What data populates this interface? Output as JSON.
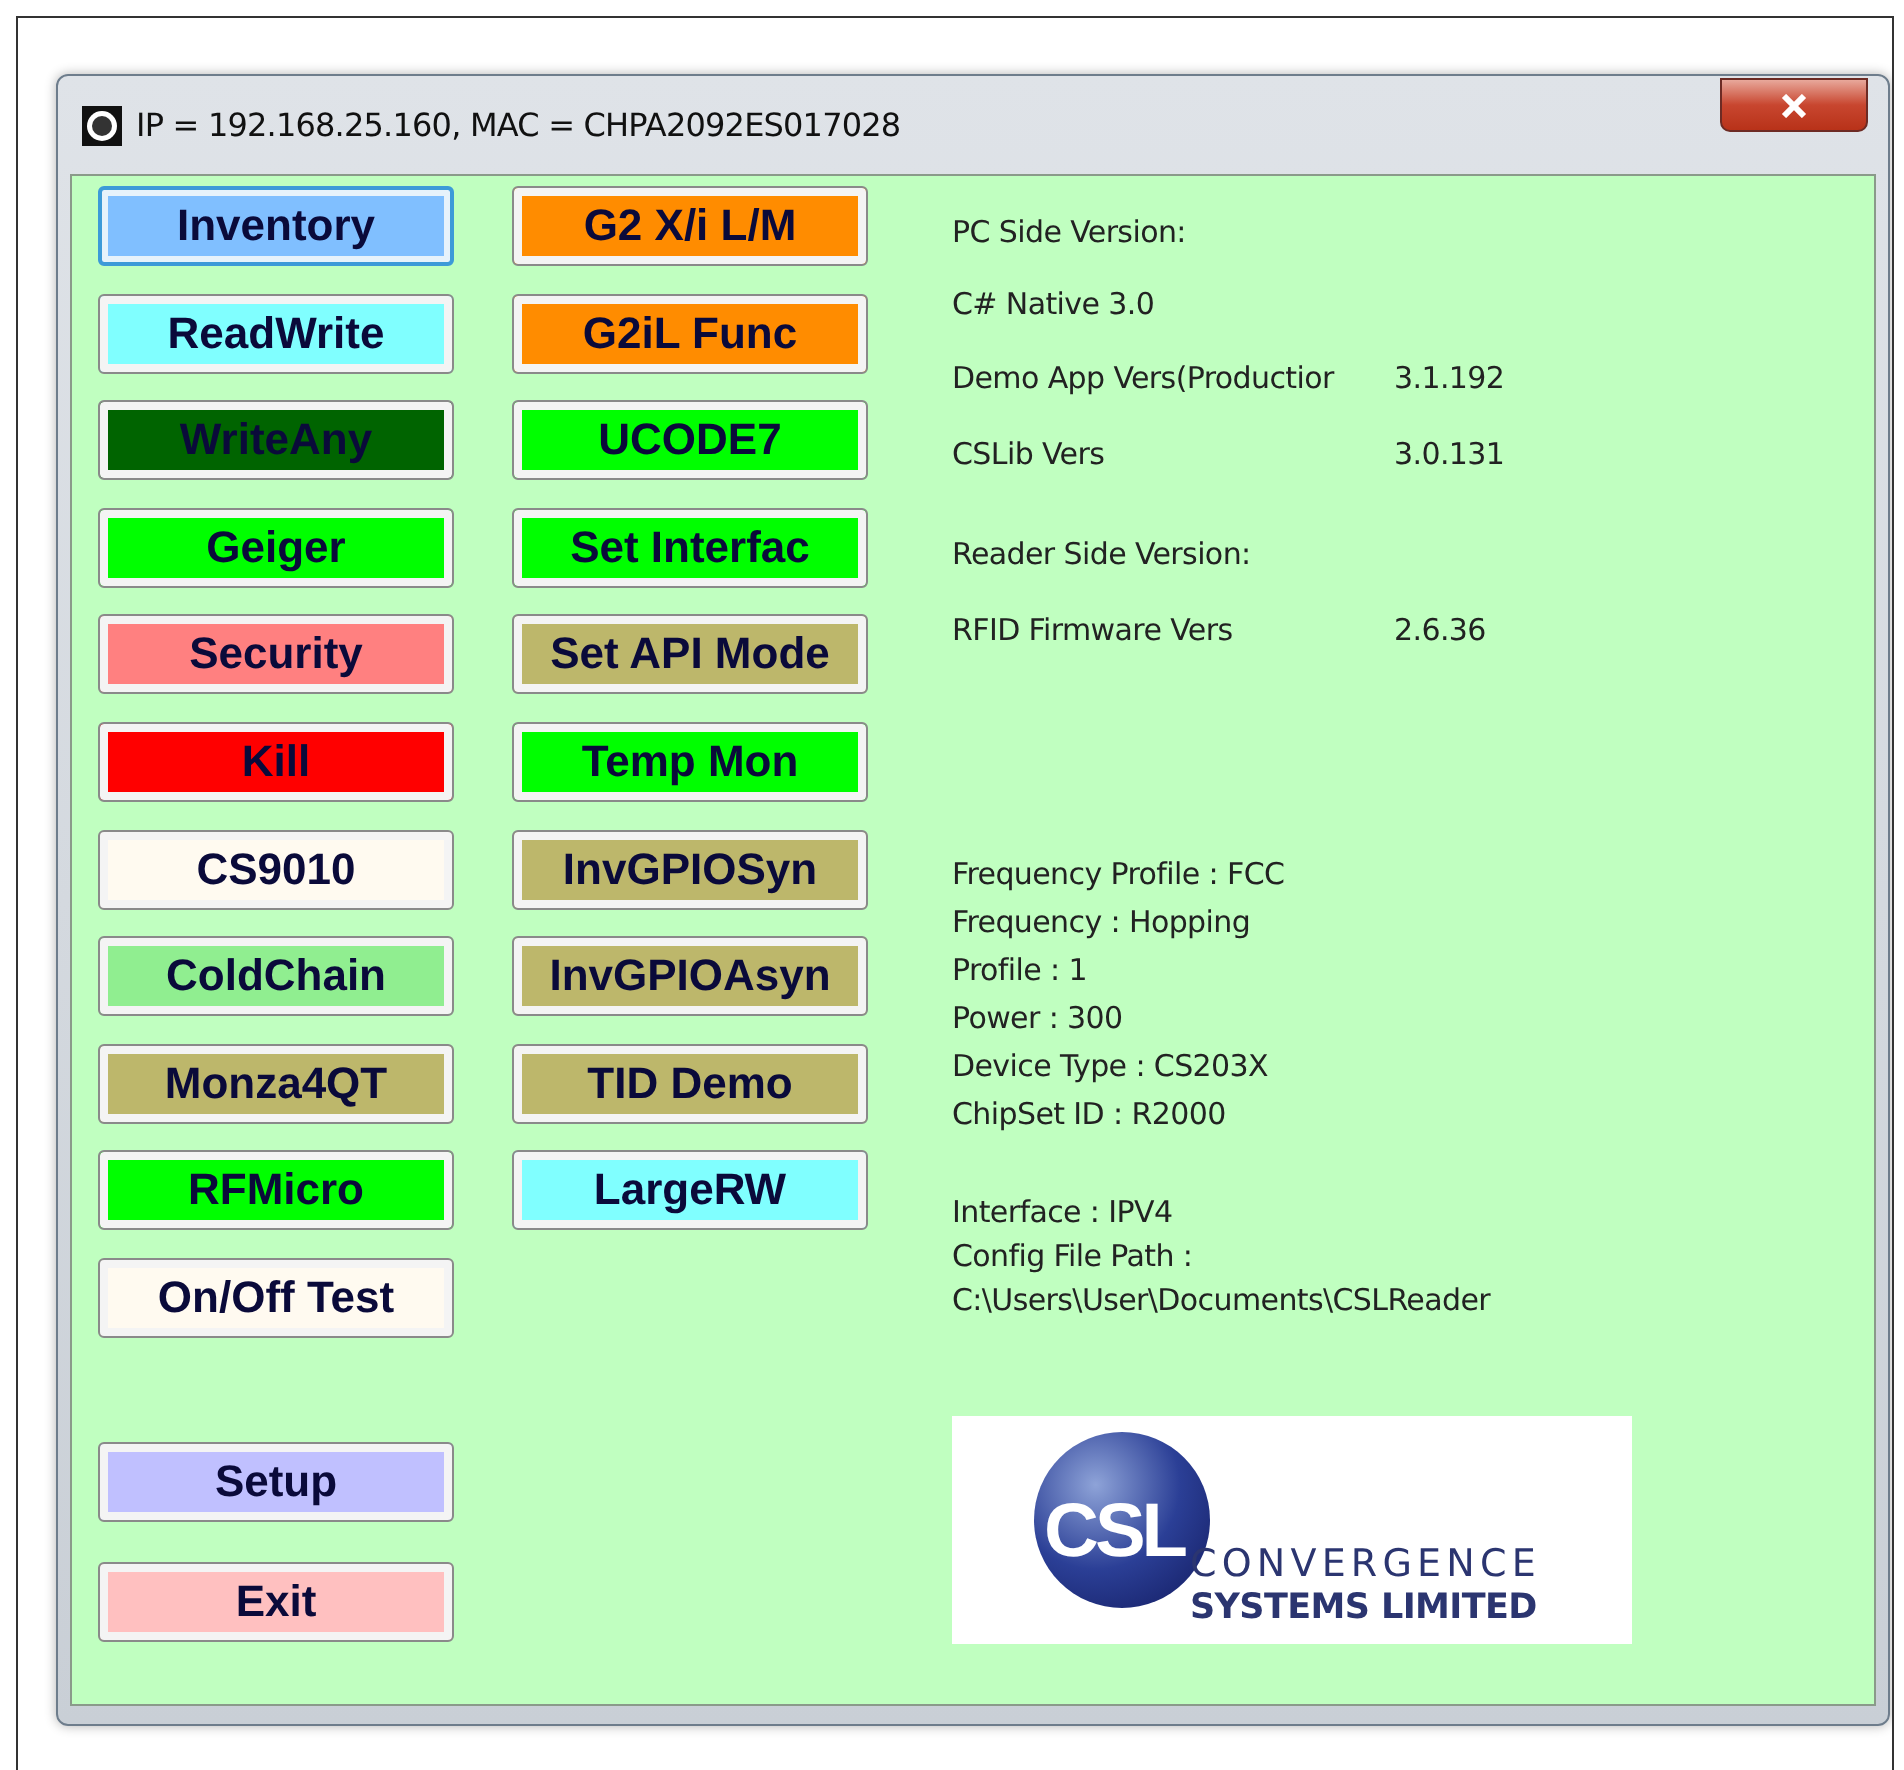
{
  "window": {
    "title": "IP = 192.168.25.160, MAC = CHPA2092ES017028"
  },
  "left_buttons": [
    {
      "label": "Inventory",
      "color": "#80bfff",
      "focused": true
    },
    {
      "label": "ReadWrite",
      "color": "#80ffff",
      "focused": false
    },
    {
      "label": "WriteAny",
      "color": "#006400",
      "focused": false
    },
    {
      "label": "Geiger",
      "color": "#00ff00",
      "focused": false
    },
    {
      "label": "Security",
      "color": "#ff8080",
      "focused": false
    },
    {
      "label": "Kill",
      "color": "#ff0000",
      "focused": false
    },
    {
      "label": "CS9010",
      "color": "#fffaf0",
      "focused": false
    },
    {
      "label": "ColdChain",
      "color": "#90ee90",
      "focused": false
    },
    {
      "label": "Monza4QT",
      "color": "#bdb76b",
      "focused": false
    },
    {
      "label": "RFMicro",
      "color": "#00ff00",
      "focused": false
    },
    {
      "label": "On/Off Test",
      "color": "#fffaf0",
      "focused": false
    }
  ],
  "right_buttons": [
    {
      "label": "G2 X/i L/M",
      "color": "#ff8c00",
      "focused": false
    },
    {
      "label": "G2iL Func",
      "color": "#ff8c00",
      "focused": false
    },
    {
      "label": "UCODE7",
      "color": "#00ff00",
      "focused": false
    },
    {
      "label": "Set Interfac",
      "color": "#00ff00",
      "focused": false
    },
    {
      "label": "Set API Mode",
      "color": "#bdb76b",
      "focused": false
    },
    {
      "label": "Temp Mon",
      "color": "#00ff00",
      "focused": false
    },
    {
      "label": "InvGPIOSyn",
      "color": "#bdb76b",
      "focused": false
    },
    {
      "label": "InvGPIOAsyn",
      "color": "#bdb76b",
      "focused": false
    },
    {
      "label": "TID Demo",
      "color": "#bdb76b",
      "focused": false
    },
    {
      "label": "LargeRW",
      "color": "#80ffff",
      "focused": false
    }
  ],
  "bottom_buttons": [
    {
      "label": "Setup",
      "color": "#c0c0ff",
      "focused": false
    },
    {
      "label": "Exit",
      "color": "#ffc0c0",
      "focused": false
    }
  ],
  "pc_side": {
    "heading": "PC Side Version:",
    "native": "C# Native 3.0",
    "rows": [
      {
        "label": "Demo App Vers(Productior",
        "value": "3.1.192"
      },
      {
        "label": "CSLib Vers",
        "value": "3.0.131"
      }
    ]
  },
  "reader_side": {
    "heading": "Reader Side Version:",
    "rows": [
      {
        "label": "RFID Firmware Vers",
        "value": "2.6.36"
      }
    ]
  },
  "reader_info": [
    "Frequency Profile : FCC",
    "Frequency : Hopping",
    "Profile : 1",
    "Power : 300",
    "Device Type : CS203X",
    "ChipSet ID : R2000"
  ],
  "interface_info": [
    "Interface : IPV4",
    "Config File Path :",
    "C:\\Users\\User\\Documents\\CSLReader"
  ],
  "logo": {
    "mark": "CSL",
    "line_1": "CONVERGENCE",
    "line_2": "SYSTEMS LIMITED"
  }
}
